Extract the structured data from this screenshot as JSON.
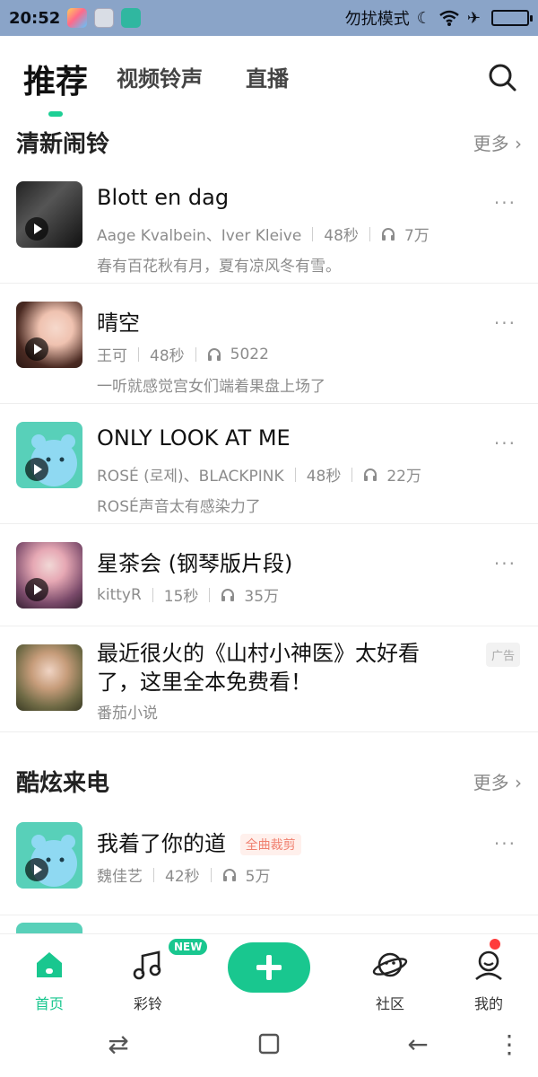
{
  "status_bar": {
    "time": "20:52",
    "dnd_text": "勿扰模式"
  },
  "top_tabs": [
    {
      "label": "推荐"
    },
    {
      "label": "视频铃声"
    },
    {
      "label": "直播"
    }
  ],
  "sections": [
    {
      "title": "清新闹铃",
      "more": "更多 ›"
    },
    {
      "title": "酷炫来电",
      "more": "更多 ›"
    }
  ],
  "songs": [
    {
      "title": "Blott en dag",
      "artist": "Aage Kvalbein、Iver Kleive",
      "duration": "48秒",
      "plays": "7万",
      "desc": "春有百花秋有月，夏有凉风冬有雪。"
    },
    {
      "title": "晴空",
      "artist": "王可",
      "duration": "48秒",
      "plays": "5022",
      "desc": "一听就感觉宫女们端着果盘上场了"
    },
    {
      "title": "ONLY LOOK AT ME",
      "artist": "ROSÉ (로제)、BLACKPINK",
      "duration": "48秒",
      "plays": "22万",
      "desc": "ROSÉ声音太有感染力了"
    },
    {
      "title": "星茶会 (钢琴版片段)",
      "artist": "kittyR",
      "duration": "15秒",
      "plays": "35万",
      "desc": ""
    }
  ],
  "ad": {
    "title_line1": "最近很火的《山村小神医》太好看",
    "title_line2": "了，这里全本免费看！",
    "source": "番茄小说",
    "tag": "广告"
  },
  "cool_call": [
    {
      "title": "我着了你的道",
      "badge": "全曲裁剪",
      "artist": "魏佳艺",
      "duration": "42秒",
      "plays": "5万"
    }
  ],
  "bottom_nav": [
    {
      "label": "首页"
    },
    {
      "label": "彩铃"
    },
    {
      "label": "社区"
    },
    {
      "label": "我的"
    }
  ],
  "new_badge": "NEW",
  "colors": {
    "accent": "#19c78f",
    "status_bar_bg": "#8aa4c8",
    "text_primary": "#111111",
    "text_secondary": "#8c8c8c"
  }
}
